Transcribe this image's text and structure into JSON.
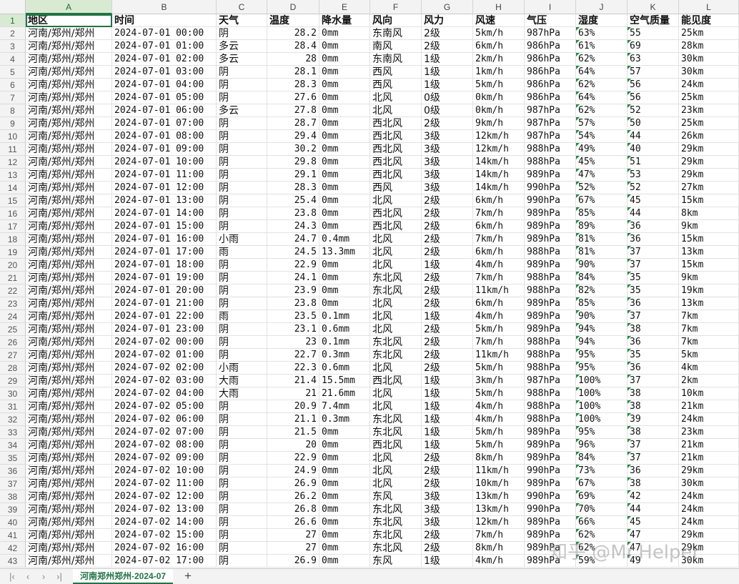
{
  "sheet_tab": "河南郑州郑州-2024-07",
  "watermark": "知乎 @Mr.Helper",
  "columns": [
    "A",
    "B",
    "C",
    "D",
    "E",
    "F",
    "G",
    "H",
    "I",
    "J",
    "K",
    "L"
  ],
  "header": [
    "地区",
    "时间",
    "天气",
    "温度",
    "降水量",
    "风向",
    "风力",
    "风速",
    "气压",
    "湿度",
    "空气质量",
    "能见度"
  ],
  "rows": [
    [
      "河南/郑州/郑州",
      "2024-07-01 00:00",
      "阴",
      "28.2",
      "0mm",
      "东南风",
      "2级",
      "5km/h",
      "987hPa",
      "63%",
      "55",
      "25km"
    ],
    [
      "河南/郑州/郑州",
      "2024-07-01 01:00",
      "多云",
      "28.4",
      "0mm",
      "南风",
      "2级",
      "6km/h",
      "986hPa",
      "61%",
      "69",
      "28km"
    ],
    [
      "河南/郑州/郑州",
      "2024-07-01 02:00",
      "多云",
      "28",
      "0mm",
      "东南风",
      "1级",
      "2km/h",
      "986hPa",
      "62%",
      "63",
      "30km"
    ],
    [
      "河南/郑州/郑州",
      "2024-07-01 03:00",
      "阴",
      "28.1",
      "0mm",
      "西风",
      "1级",
      "1km/h",
      "986hPa",
      "64%",
      "57",
      "30km"
    ],
    [
      "河南/郑州/郑州",
      "2024-07-01 04:00",
      "阴",
      "28.3",
      "0mm",
      "西风",
      "1级",
      "5km/h",
      "986hPa",
      "62%",
      "56",
      "24km"
    ],
    [
      "河南/郑州/郑州",
      "2024-07-01 05:00",
      "阴",
      "27.6",
      "0mm",
      "北风",
      "0级",
      "0km/h",
      "986hPa",
      "64%",
      "56",
      "25km"
    ],
    [
      "河南/郑州/郑州",
      "2024-07-01 06:00",
      "多云",
      "27.8",
      "0mm",
      "北风",
      "0级",
      "0km/h",
      "987hPa",
      "62%",
      "52",
      "23km"
    ],
    [
      "河南/郑州/郑州",
      "2024-07-01 07:00",
      "阴",
      "28.7",
      "0mm",
      "西北风",
      "2级",
      "9km/h",
      "987hPa",
      "57%",
      "50",
      "25km"
    ],
    [
      "河南/郑州/郑州",
      "2024-07-01 08:00",
      "阴",
      "29.4",
      "0mm",
      "西北风",
      "3级",
      "12km/h",
      "987hPa",
      "54%",
      "44",
      "26km"
    ],
    [
      "河南/郑州/郑州",
      "2024-07-01 09:00",
      "阴",
      "30.2",
      "0mm",
      "西北风",
      "3级",
      "12km/h",
      "988hPa",
      "49%",
      "40",
      "29km"
    ],
    [
      "河南/郑州/郑州",
      "2024-07-01 10:00",
      "阴",
      "29.8",
      "0mm",
      "西北风",
      "3级",
      "14km/h",
      "988hPa",
      "45%",
      "51",
      "29km"
    ],
    [
      "河南/郑州/郑州",
      "2024-07-01 11:00",
      "阴",
      "29.1",
      "0mm",
      "西北风",
      "3级",
      "14km/h",
      "989hPa",
      "47%",
      "53",
      "29km"
    ],
    [
      "河南/郑州/郑州",
      "2024-07-01 12:00",
      "阴",
      "28.3",
      "0mm",
      "西风",
      "3级",
      "14km/h",
      "990hPa",
      "52%",
      "52",
      "27km"
    ],
    [
      "河南/郑州/郑州",
      "2024-07-01 13:00",
      "阴",
      "25.4",
      "0mm",
      "北风",
      "2级",
      "6km/h",
      "990hPa",
      "67%",
      "45",
      "15km"
    ],
    [
      "河南/郑州/郑州",
      "2024-07-01 14:00",
      "阴",
      "23.8",
      "0mm",
      "西北风",
      "2级",
      "7km/h",
      "989hPa",
      "85%",
      "44",
      "8km"
    ],
    [
      "河南/郑州/郑州",
      "2024-07-01 15:00",
      "阴",
      "24.3",
      "0mm",
      "西北风",
      "2级",
      "6km/h",
      "989hPa",
      "89%",
      "36",
      "9km"
    ],
    [
      "河南/郑州/郑州",
      "2024-07-01 16:00",
      "小雨",
      "24.7",
      "0.4mm",
      "北风",
      "2级",
      "7km/h",
      "989hPa",
      "81%",
      "36",
      "15km"
    ],
    [
      "河南/郑州/郑州",
      "2024-07-01 17:00",
      "雨",
      "24.5",
      "13.3mm",
      "北风",
      "2级",
      "6km/h",
      "988hPa",
      "81%",
      "37",
      "13km"
    ],
    [
      "河南/郑州/郑州",
      "2024-07-01 18:00",
      "阴",
      "22.9",
      "0mm",
      "北风",
      "1级",
      "4km/h",
      "989hPa",
      "90%",
      "37",
      "15km"
    ],
    [
      "河南/郑州/郑州",
      "2024-07-01 19:00",
      "阴",
      "24.1",
      "0mm",
      "东北风",
      "2级",
      "7km/h",
      "988hPa",
      "84%",
      "35",
      "9km"
    ],
    [
      "河南/郑州/郑州",
      "2024-07-01 20:00",
      "阴",
      "23.9",
      "0mm",
      "东北风",
      "2级",
      "11km/h",
      "988hPa",
      "82%",
      "35",
      "19km"
    ],
    [
      "河南/郑州/郑州",
      "2024-07-01 21:00",
      "阴",
      "23.8",
      "0mm",
      "北风",
      "2级",
      "6km/h",
      "989hPa",
      "85%",
      "36",
      "13km"
    ],
    [
      "河南/郑州/郑州",
      "2024-07-01 22:00",
      "雨",
      "23.5",
      "0.1mm",
      "北风",
      "1级",
      "4km/h",
      "989hPa",
      "90%",
      "37",
      "7km"
    ],
    [
      "河南/郑州/郑州",
      "2024-07-01 23:00",
      "阴",
      "23.1",
      "0.6mm",
      "北风",
      "2级",
      "5km/h",
      "989hPa",
      "94%",
      "38",
      "7km"
    ],
    [
      "河南/郑州/郑州",
      "2024-07-02 00:00",
      "阴",
      "23",
      "0.1mm",
      "东北风",
      "2级",
      "7km/h",
      "988hPa",
      "94%",
      "36",
      "7km"
    ],
    [
      "河南/郑州/郑州",
      "2024-07-02 01:00",
      "阴",
      "22.7",
      "0.3mm",
      "东北风",
      "2级",
      "11km/h",
      "988hPa",
      "95%",
      "35",
      "5km"
    ],
    [
      "河南/郑州/郑州",
      "2024-07-02 02:00",
      "小雨",
      "22.3",
      "0.6mm",
      "北风",
      "2级",
      "5km/h",
      "988hPa",
      "95%",
      "36",
      "4km"
    ],
    [
      "河南/郑州/郑州",
      "2024-07-02 03:00",
      "大雨",
      "21.4",
      "15.5mm",
      "西北风",
      "1级",
      "3km/h",
      "987hPa",
      "100%",
      "37",
      "2km"
    ],
    [
      "河南/郑州/郑州",
      "2024-07-02 04:00",
      "大雨",
      "21",
      "21.6mm",
      "北风",
      "1级",
      "5km/h",
      "988hPa",
      "100%",
      "38",
      "10km"
    ],
    [
      "河南/郑州/郑州",
      "2024-07-02 05:00",
      "阴",
      "20.9",
      "7.4mm",
      "北风",
      "1级",
      "4km/h",
      "988hPa",
      "100%",
      "38",
      "21km"
    ],
    [
      "河南/郑州/郑州",
      "2024-07-02 06:00",
      "阴",
      "21.1",
      "0.3mm",
      "东北风",
      "1级",
      "4km/h",
      "988hPa",
      "100%",
      "39",
      "24km"
    ],
    [
      "河南/郑州/郑州",
      "2024-07-02 07:00",
      "阴",
      "21.5",
      "0mm",
      "东北风",
      "1级",
      "5km/h",
      "989hPa",
      "95%",
      "38",
      "23km"
    ],
    [
      "河南/郑州/郑州",
      "2024-07-02 08:00",
      "阴",
      "20",
      "0mm",
      "西北风",
      "1级",
      "5km/h",
      "989hPa",
      "96%",
      "37",
      "21km"
    ],
    [
      "河南/郑州/郑州",
      "2024-07-02 09:00",
      "阴",
      "22.9",
      "0mm",
      "北风",
      "2级",
      "8km/h",
      "989hPa",
      "84%",
      "37",
      "21km"
    ],
    [
      "河南/郑州/郑州",
      "2024-07-02 10:00",
      "阴",
      "24.9",
      "0mm",
      "北风",
      "2级",
      "11km/h",
      "990hPa",
      "73%",
      "36",
      "29km"
    ],
    [
      "河南/郑州/郑州",
      "2024-07-02 11:00",
      "阴",
      "26.9",
      "0mm",
      "北风",
      "2级",
      "10km/h",
      "989hPa",
      "67%",
      "38",
      "30km"
    ],
    [
      "河南/郑州/郑州",
      "2024-07-02 12:00",
      "阴",
      "26.2",
      "0mm",
      "东风",
      "3级",
      "13km/h",
      "990hPa",
      "69%",
      "42",
      "24km"
    ],
    [
      "河南/郑州/郑州",
      "2024-07-02 13:00",
      "阴",
      "26.8",
      "0mm",
      "东北风",
      "3级",
      "13km/h",
      "990hPa",
      "70%",
      "44",
      "24km"
    ],
    [
      "河南/郑州/郑州",
      "2024-07-02 14:00",
      "阴",
      "26.6",
      "0mm",
      "东北风",
      "3级",
      "12km/h",
      "989hPa",
      "66%",
      "45",
      "24km"
    ],
    [
      "河南/郑州/郑州",
      "2024-07-02 15:00",
      "阴",
      "27",
      "0mm",
      "东北风",
      "2级",
      "7km/h",
      "989hPa",
      "62%",
      "47",
      "29km"
    ],
    [
      "河南/郑州/郑州",
      "2024-07-02 16:00",
      "阴",
      "27",
      "0mm",
      "东北风",
      "2级",
      "8km/h",
      "989hPa",
      "62%",
      "47",
      "29km"
    ],
    [
      "河南/郑州/郑州",
      "2024-07-02 17:00",
      "阴",
      "26.9",
      "0mm",
      "东风",
      "1级",
      "4km/h",
      "989hPa",
      "59%",
      "49",
      "30km"
    ]
  ]
}
